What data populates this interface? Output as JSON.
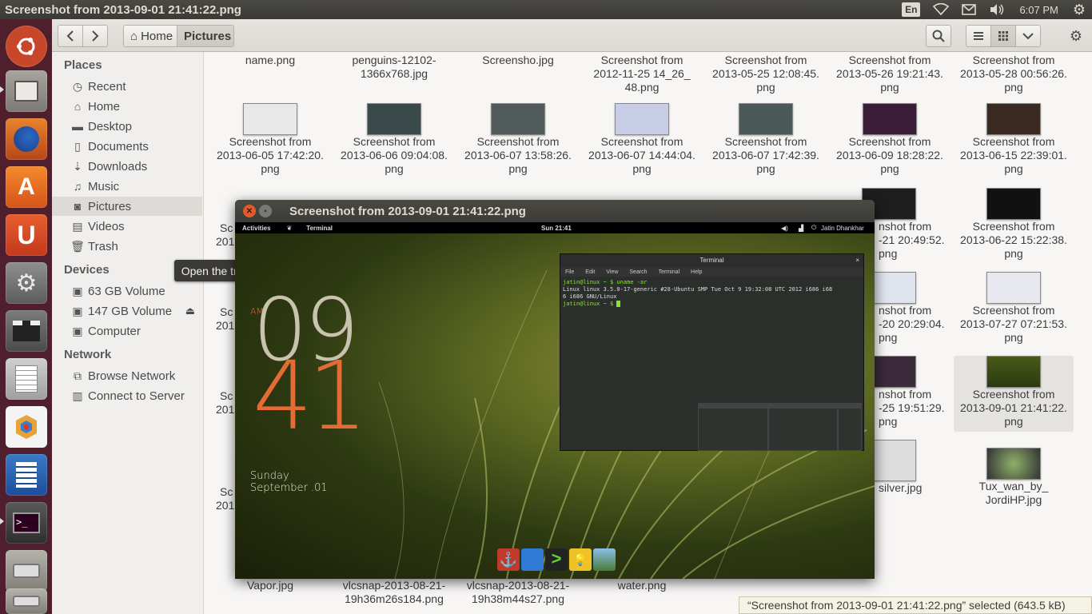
{
  "window_title": "Screenshot from 2013-09-01 21:41:22.png",
  "indicators": {
    "keyboard": "En",
    "time": "6:07 PM"
  },
  "launcher": {
    "items": [
      "dash-home",
      "files",
      "firefox",
      "software-center",
      "ubuntu-one",
      "system-settings",
      "video-editor",
      "text-editor",
      "app-icon",
      "libreoffice-writer",
      "terminal",
      "disk",
      "disk-2"
    ]
  },
  "toolbar": {
    "home_label": "Home",
    "current_label": "Pictures"
  },
  "sidebar": {
    "places_heading": "Places",
    "places": [
      {
        "label": "Recent",
        "icon": "clock-icon"
      },
      {
        "label": "Home",
        "icon": "home-icon"
      },
      {
        "label": "Desktop",
        "icon": "folder-icon"
      },
      {
        "label": "Documents",
        "icon": "document-icon"
      },
      {
        "label": "Downloads",
        "icon": "download-icon"
      },
      {
        "label": "Music",
        "icon": "music-icon"
      },
      {
        "label": "Pictures",
        "icon": "camera-icon"
      },
      {
        "label": "Videos",
        "icon": "video-icon"
      },
      {
        "label": "Trash",
        "icon": "trash-icon"
      }
    ],
    "devices_heading": "Devices",
    "devices": [
      {
        "label": "63 GB Volume"
      },
      {
        "label": "147 GB Volume"
      },
      {
        "label": "Computer"
      }
    ],
    "network_heading": "Network",
    "network": [
      {
        "label": "Browse Network"
      },
      {
        "label": "Connect to Server"
      }
    ]
  },
  "tooltip": "Open the trash",
  "files": {
    "row0": [
      "name.png",
      "penguins-12102-\n1366x768.jpg",
      "Screensho.jpg",
      "Screenshot from\n2012-11-25 14_26_\n48.png",
      "Screenshot from\n2013-05-25 12:08:45.\npng",
      "Screenshot from\n2013-05-26 19:21:43.\npng",
      "Screenshot from\n2013-05-28 00:56:26.\npng"
    ],
    "row1": [
      "Screenshot from\n2013-06-05 17:42:20.\npng",
      "Screenshot from\n2013-06-06 09:04:08.\npng",
      "Screenshot from\n2013-06-07 13:58:26.\npng",
      "Screenshot from\n2013-06-07 14:44:04.\npng",
      "Screenshot from\n2013-06-07 17:42:39.\npng",
      "Screenshot from\n2013-06-09 18:28:22.\npng",
      "Screenshot from\n2013-06-15 22:39:01.\npng"
    ],
    "row2_right": [
      "nshot from\n-21 20:49:52.\npng",
      "Screenshot from\n2013-06-22 15:22:38.\npng"
    ],
    "row3_right": [
      "nshot from\n-20 20:29:04.\npng",
      "Screenshot from\n2013-07-27 07:21:53.\npng"
    ],
    "row4_right": [
      "nshot from\n-25 19:51:29.\npng",
      "Screenshot from\n2013-09-01 21:41:22.\npng"
    ],
    "row5_right": [
      "silver.jpg",
      "Tux_wan_by_\nJordiHP.jpg"
    ],
    "row6": [
      "Vapor.jpg",
      "vlcsnap-2013-08-21-\n19h36m26s184.png",
      "vlcsnap-2013-08-21-\n19h38m44s27.png",
      "water.png"
    ],
    "left_partial": [
      "Sc",
      "201",
      "Sc",
      "201",
      "Sc",
      "201",
      "Sc",
      "201"
    ]
  },
  "viewer": {
    "title": "Screenshot from 2013-09-01 21:41:22.png",
    "gnome_bar": {
      "activities": "Activities",
      "app": "Terminal",
      "clock": "Sun 21:41",
      "user": "Jatin Dhankhar"
    },
    "clock_widget": {
      "ampm": "AM",
      "hour": "09",
      "minute": "41",
      "day": "Sunday",
      "date": "September .01"
    },
    "terminal": {
      "title": "Terminal",
      "menu": [
        "File",
        "Edit",
        "View",
        "Search",
        "Terminal",
        "Help"
      ],
      "lines": [
        "jatin@linux ~ $ uname -ar",
        "Linux linux 3.5.0-17-generic #28-Ubuntu SMP Tue Oct 9 19:32:08 UTC 2012 i686 i68",
        "6 i686 GNU/Linux",
        "jatin@linux ~ $ "
      ]
    }
  },
  "status": "“Screenshot from 2013-09-01 21:41:22.png” selected  (643.5 kB)",
  "colors": {
    "launcher_bg": "#4f1f2e",
    "top_panel": "#3c3b37",
    "accent_orange": "#dd4814"
  }
}
